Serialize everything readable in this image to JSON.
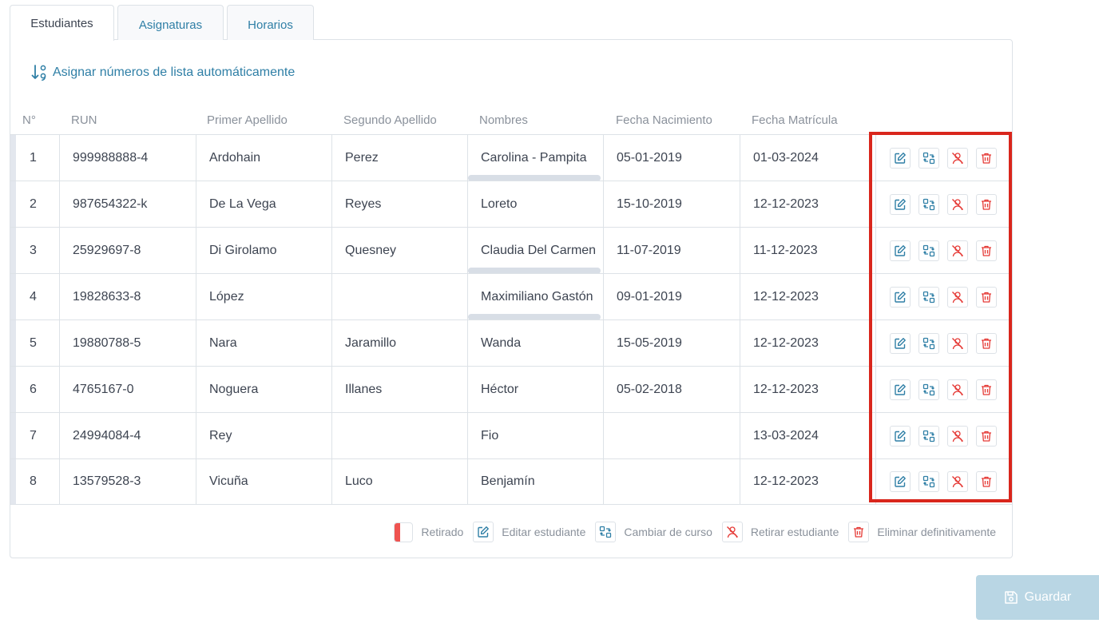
{
  "tabs": [
    {
      "label": "Estudiantes",
      "active": true
    },
    {
      "label": "Asignaturas",
      "active": false
    },
    {
      "label": "Horarios",
      "active": false
    }
  ],
  "auto_assign_label": "Asignar números de lista automáticamente",
  "columns": [
    "N°",
    "RUN",
    "Primer Apellido",
    "Segundo Apellido",
    "Nombres",
    "Fecha Nacimiento",
    "Fecha Matrícula"
  ],
  "students": [
    {
      "n": "1",
      "run": "999988888-4",
      "apellido1": "Ardohain",
      "apellido2": "Perez",
      "nombres": "Carolina - Pampita",
      "nacimiento": "05-01-2019",
      "matricula": "01-03-2024"
    },
    {
      "n": "2",
      "run": "987654322-k",
      "apellido1": "De La Vega",
      "apellido2": "Reyes",
      "nombres": "Loreto",
      "nacimiento": "15-10-2019",
      "matricula": "12-12-2023"
    },
    {
      "n": "3",
      "run": "25929697-8",
      "apellido1": "Di Girolamo",
      "apellido2": "Quesney",
      "nombres": "Claudia Del Carmen",
      "nacimiento": "11-07-2019",
      "matricula": "11-12-2023"
    },
    {
      "n": "4",
      "run": "19828633-8",
      "apellido1": "López",
      "apellido2": "",
      "nombres": "Maximiliano Gastón",
      "nacimiento": "09-01-2019",
      "matricula": "12-12-2023"
    },
    {
      "n": "5",
      "run": "19880788-5",
      "apellido1": "Nara",
      "apellido2": "Jaramillo",
      "nombres": "Wanda",
      "nacimiento": "15-05-2019",
      "matricula": "12-12-2023"
    },
    {
      "n": "6",
      "run": "4765167-0",
      "apellido1": "Noguera",
      "apellido2": "Illanes",
      "nombres": "Héctor",
      "nacimiento": "05-02-2018",
      "matricula": "12-12-2023"
    },
    {
      "n": "7",
      "run": "24994084-4",
      "apellido1": "Rey",
      "apellido2": "",
      "nombres": "Fio",
      "nacimiento": "",
      "matricula": "13-03-2024"
    },
    {
      "n": "8",
      "run": "13579528-3",
      "apellido1": "Vicuña",
      "apellido2": "Luco",
      "nombres": "Benjamín",
      "nacimiento": "",
      "matricula": "12-12-2023"
    }
  ],
  "row_actions": [
    {
      "icon": "edit-icon",
      "color": "#2f7fa6"
    },
    {
      "icon": "swap-course-icon",
      "color": "#2f7fa6"
    },
    {
      "icon": "withdraw-student-icon",
      "color": "#e53935"
    },
    {
      "icon": "trash-icon",
      "color": "#e53935"
    }
  ],
  "legend": {
    "retirado": "Retirado",
    "editar": "Editar estudiante",
    "cambiar": "Cambiar de curso",
    "retirar": "Retirar estudiante",
    "eliminar": "Eliminar definitivamente"
  },
  "save_label": "Guardar",
  "colors": {
    "accent": "#2f7fa6",
    "danger": "#e53935",
    "highlight": "#d9261c",
    "save_bg": "#b9d6e4"
  }
}
